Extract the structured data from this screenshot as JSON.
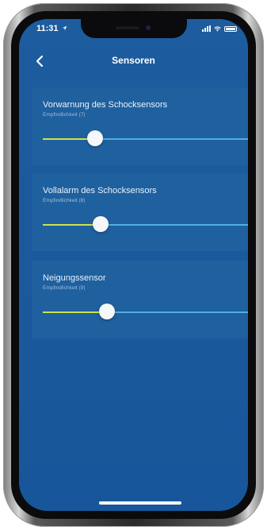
{
  "status_bar": {
    "time": "11:31",
    "location_arrow": "location-arrow-icon"
  },
  "navbar": {
    "back_icon": "chevron-left-icon",
    "title": "Sensoren"
  },
  "sensors": [
    {
      "title": "Vorwarnung des Schocksensors",
      "subtitle": "Empfindlichkeit (7)",
      "level": 0.25
    },
    {
      "title": "Vollalarm des Schocksensors",
      "subtitle": "Empfindlichkeit (8)",
      "level": 0.28
    },
    {
      "title": "Neigungssensor",
      "subtitle": "Empfindlichkeit (9)",
      "level": 0.31
    }
  ],
  "colors": {
    "accent_fill": "#cfe24a",
    "track": "#4fb0e0",
    "background": "#1a5a9c"
  }
}
